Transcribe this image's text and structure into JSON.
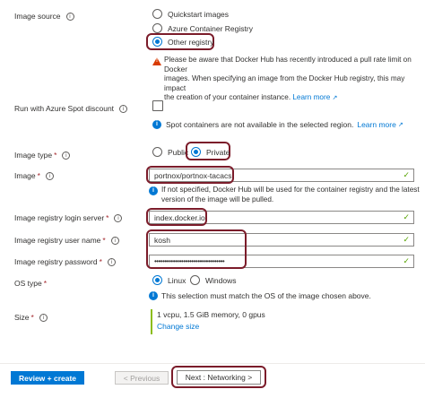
{
  "image_source": {
    "label": "Image source",
    "options": [
      "Quickstart images",
      "Azure Container Registry",
      "Other registry"
    ],
    "selected": "Other registry",
    "warning_line1": "Please be aware that Docker Hub has recently introduced a pull rate limit on Docker",
    "warning_line2": "images. When specifying an image from the Docker Hub registry, this may impact",
    "warning_line3": "the creation of your container instance.",
    "warning_link": "Learn more"
  },
  "spot": {
    "label": "Run with Azure Spot discount",
    "message": "Spot containers are not available in the selected region.",
    "link": "Learn more"
  },
  "image_type": {
    "label": "Image type",
    "options": [
      "Public",
      "Private"
    ],
    "selected": "Private"
  },
  "image": {
    "label": "Image",
    "value": "portnox/portnox-tacacs",
    "hint_line1": "If not specified, Docker Hub will be used for the container registry and the latest",
    "hint_line2": "version of the image will be pulled."
  },
  "login_server": {
    "label": "Image registry login server",
    "value": "index.docker.io"
  },
  "user_name": {
    "label": "Image registry user name",
    "value": "kosh"
  },
  "password": {
    "label": "Image registry password",
    "value": "••••••••••••••••••••••••••••••••••"
  },
  "os_type": {
    "label": "OS type",
    "options": [
      "Linux",
      "Windows"
    ],
    "selected": "Linux",
    "message": "This selection must match the OS of the image chosen above."
  },
  "size": {
    "label": "Size",
    "value": "1 vcpu, 1.5 GiB memory, 0 gpus",
    "link": "Change size"
  },
  "footer": {
    "review_create": "Review + create",
    "previous": "< Previous",
    "next": "Next : Networking >"
  },
  "required_mark": "*",
  "colors": {
    "accent": "#0078d4",
    "highlight": "#7b1c2a",
    "success": "#57a300",
    "warning": "#d83b01"
  }
}
